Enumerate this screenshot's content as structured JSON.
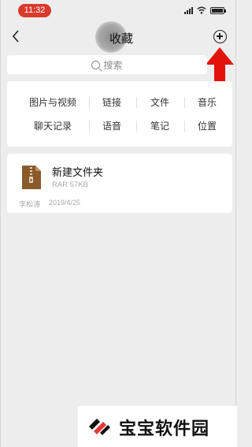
{
  "status_bar": {
    "time": "11:32",
    "colors": {
      "time_pill": "#d93a2c"
    }
  },
  "nav": {
    "title": "收藏",
    "back_icon": "chevron-left-icon",
    "add_icon": "plus-circle-icon"
  },
  "search": {
    "placeholder": "搜索",
    "icon": "search-icon"
  },
  "categories": [
    {
      "label": "图片与视频"
    },
    {
      "label": "链接"
    },
    {
      "label": "文件"
    },
    {
      "label": "音乐"
    },
    {
      "label": "聊天记录"
    },
    {
      "label": "语音"
    },
    {
      "label": "笔记"
    },
    {
      "label": "位置"
    }
  ],
  "favorites": [
    {
      "name": "新建文件夹",
      "meta": "RAR 57KB",
      "author": "李松涛",
      "date": "2019/4/25",
      "icon": "zip-file-icon"
    }
  ],
  "annotation": {
    "icon": "red-up-arrow-icon",
    "color": "#e3120b"
  },
  "watermark": {
    "text": "宝宝软件园",
    "colors": {
      "red": "#e53935",
      "black": "#111111"
    }
  }
}
